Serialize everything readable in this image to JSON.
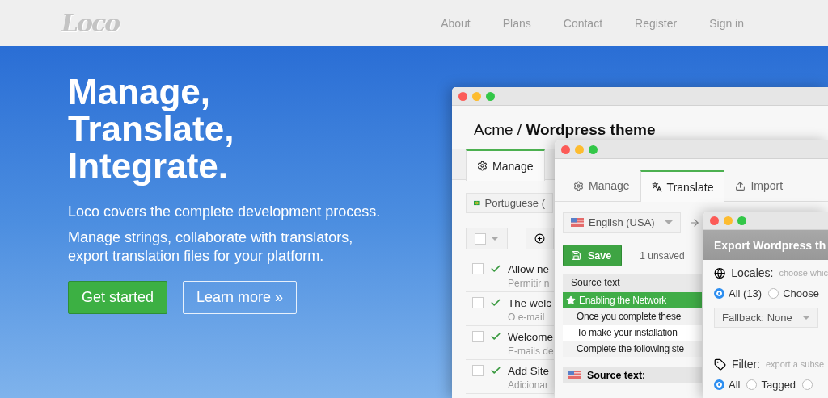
{
  "nav": {
    "logo": "Loco",
    "links": [
      "About",
      "Plans",
      "Contact",
      "Register",
      "Sign in"
    ]
  },
  "hero": {
    "heading": [
      "Manage,",
      "Translate,",
      "Integrate."
    ],
    "lead": "Loco covers the complete development process.",
    "text": "Manage strings, collaborate with translators, export translation files for your platform.",
    "buttons": [
      {
        "label": "Get started",
        "kind": "primary"
      },
      {
        "label": "Learn more »",
        "kind": "outline"
      }
    ]
  },
  "project_window": {
    "title_prefix": "Acme /",
    "title": "Wordpress theme",
    "tabs": [
      {
        "label": "Manage",
        "selected": true
      }
    ],
    "locale": "Portuguese (",
    "select_all": {
      "checked": false
    },
    "rows": [
      {
        "source": "Allow ne",
        "translation": "Permitir n",
        "checked": false,
        "done": true
      },
      {
        "source": "The welc",
        "translation": "O e-mail",
        "checked": false,
        "done": true
      },
      {
        "source": "Welcome",
        "translation": "E-mails de",
        "checked": false,
        "done": true
      },
      {
        "source": "Add Site",
        "translation": "Adicionar",
        "checked": false,
        "done": true
      }
    ]
  },
  "translate_window": {
    "tabs": [
      {
        "label": "Manage",
        "kind": "manage",
        "selected": false
      },
      {
        "label": "Translate",
        "kind": "translate",
        "selected": true
      },
      {
        "label": "Import",
        "kind": "import",
        "selected": false
      }
    ],
    "locale": "English (USA)",
    "save": "Save",
    "unsaved": "1 unsaved",
    "list_header": "Source text",
    "items": [
      {
        "text": "Enabling the Network",
        "selected": true
      },
      {
        "text": "Once you complete these",
        "selected": false
      },
      {
        "text": "To make your installation",
        "selected": false
      },
      {
        "text": "Complete the following ste",
        "selected": false
      }
    ],
    "editor_header": "Source text:"
  },
  "export_window": {
    "title": "Export Wordpress th",
    "sections": [
      {
        "kind": "globe",
        "label": "Locales:",
        "hint": "choose whic",
        "options": [
          {
            "label": "All (13)",
            "selected": true
          },
          {
            "label": "Choose",
            "selected": false
          }
        ],
        "dropdown": "Fallback: None"
      },
      {
        "kind": "tag",
        "label": "Filter:",
        "hint": "export a subse",
        "options": [
          {
            "label": "All",
            "selected": true
          },
          {
            "label": "Tagged",
            "selected": false
          },
          {
            "selected": false
          }
        ]
      }
    ]
  }
}
